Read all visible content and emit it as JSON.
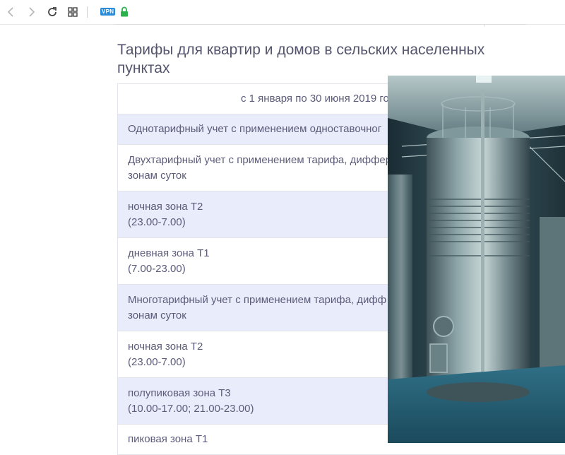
{
  "browser": {
    "vpn_label": "VPN",
    "icons": [
      "back-arrow-icon",
      "forward-arrow-icon",
      "reload-icon",
      "grid-icon",
      "lock-icon"
    ]
  },
  "page": {
    "title": "Тарифы для квартир и домов в сельских населенных пунктах"
  },
  "table": {
    "period": "с 1 января по 30 июня 2019 го",
    "rows": [
      {
        "line1": "Однотарифный учет с применением одноставочног",
        "line2": ""
      },
      {
        "line1": "Двухтарифный учет с применением тарифа, диффер",
        "line2": "зонам суток"
      },
      {
        "line1": "ночная зона Т2",
        "line2": "(23.00-7.00)"
      },
      {
        "line1": "дневная зона Т1",
        "line2": "(7.00-23.00)"
      },
      {
        "line1": "Многотарифный учет с применением тарифа, дифф",
        "line2": "зонам суток"
      },
      {
        "line1": "ночная зона Т2",
        "line2": "(23.00-7.00)"
      },
      {
        "line1": "полупиковая зона Т3",
        "line2": "(10.00-17.00; 21.00-23.00)"
      },
      {
        "line1": "пиковая зона Т1",
        "line2": ""
      }
    ]
  },
  "colors": {
    "row_shade": "#e9ecfb",
    "text": "#5c5c7a",
    "vpn_badge": "#2a8cd8",
    "lock": "#2bb24c"
  }
}
